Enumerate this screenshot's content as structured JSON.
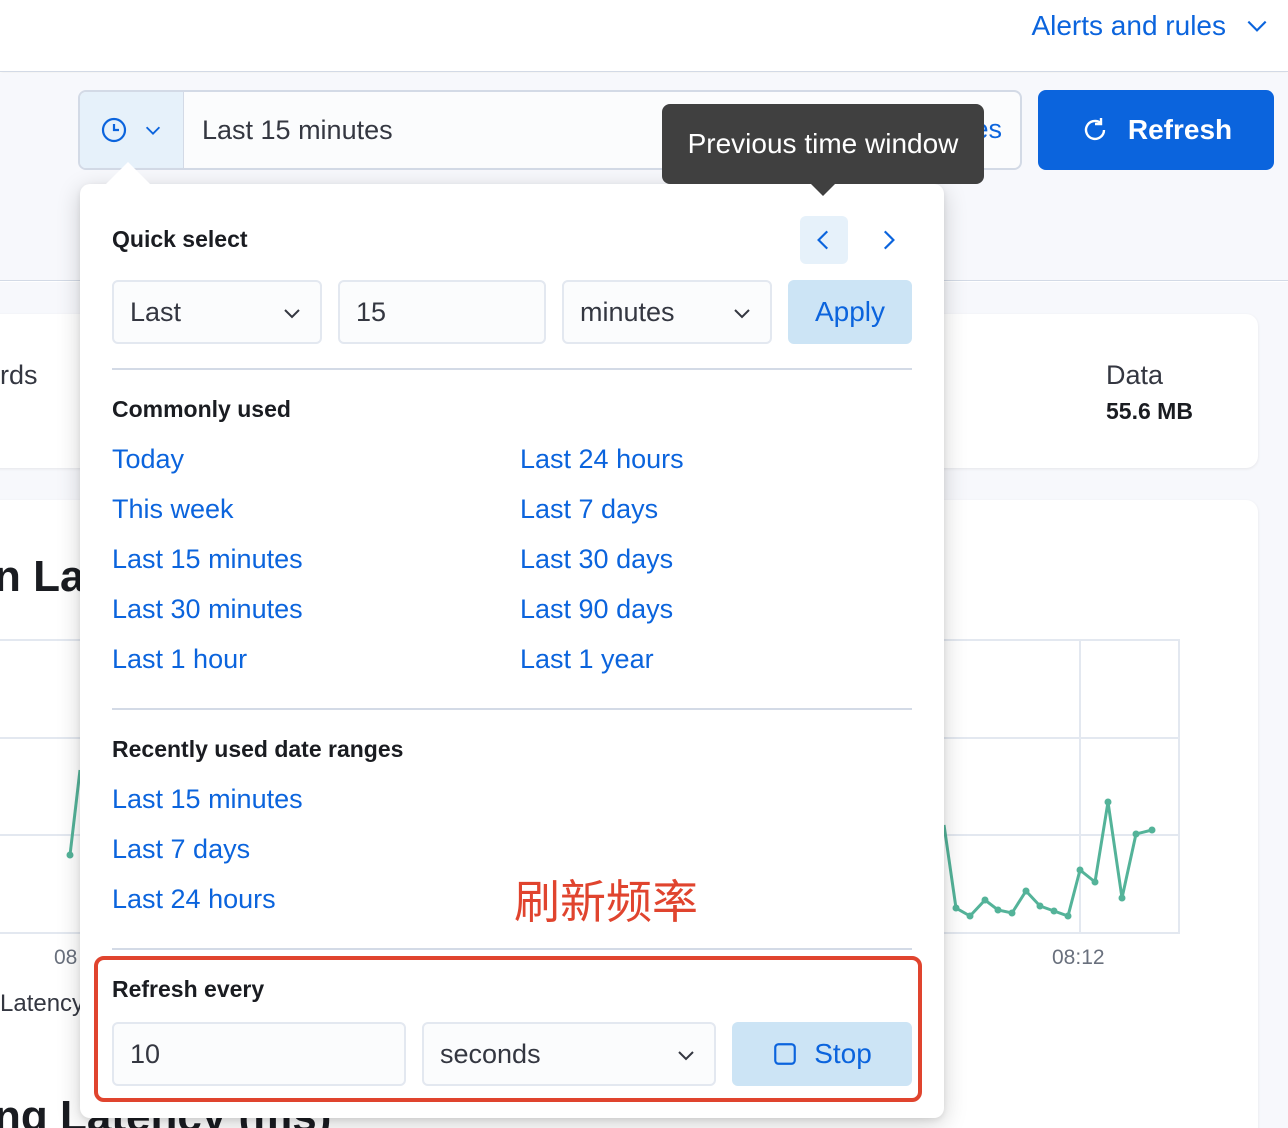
{
  "header": {
    "alerts_label": "Alerts and rules"
  },
  "datepicker": {
    "value": "Last 15 minutes",
    "hidden_tail": "es"
  },
  "refresh_button": {
    "label": "Refresh"
  },
  "tooltip": {
    "text": "Previous time window"
  },
  "quick_select": {
    "title": "Quick select",
    "tense": "Last",
    "value": "15",
    "unit": "minutes",
    "apply_label": "Apply"
  },
  "commonly_used": {
    "title": "Commonly used",
    "left": [
      "Today",
      "This week",
      "Last 15 minutes",
      "Last 30 minutes",
      "Last 1 hour"
    ],
    "right": [
      "Last 24 hours",
      "Last 7 days",
      "Last 30 days",
      "Last 90 days",
      "Last 1 year"
    ]
  },
  "recently_used": {
    "title": "Recently used date ranges",
    "items": [
      "Last 15 minutes",
      "Last 7 days",
      "Last 24 hours"
    ]
  },
  "refresh_every": {
    "title": "Refresh every",
    "value": "10",
    "unit": "seconds",
    "stop_label": "Stop"
  },
  "annotation": {
    "text": "刷新频率"
  },
  "background": {
    "stat_left": "rds",
    "data_label": "Data",
    "data_value": "55.6 MB",
    "chart_title_partial": "n Lat",
    "chart_title2_partial": "ng Latency (ms)",
    "legend_partial": "Latency",
    "tick_left": "08",
    "tick_right": "08:12"
  },
  "colors": {
    "accent": "#0b64dd",
    "annotation": "#e0442e",
    "series": "#54b399"
  }
}
